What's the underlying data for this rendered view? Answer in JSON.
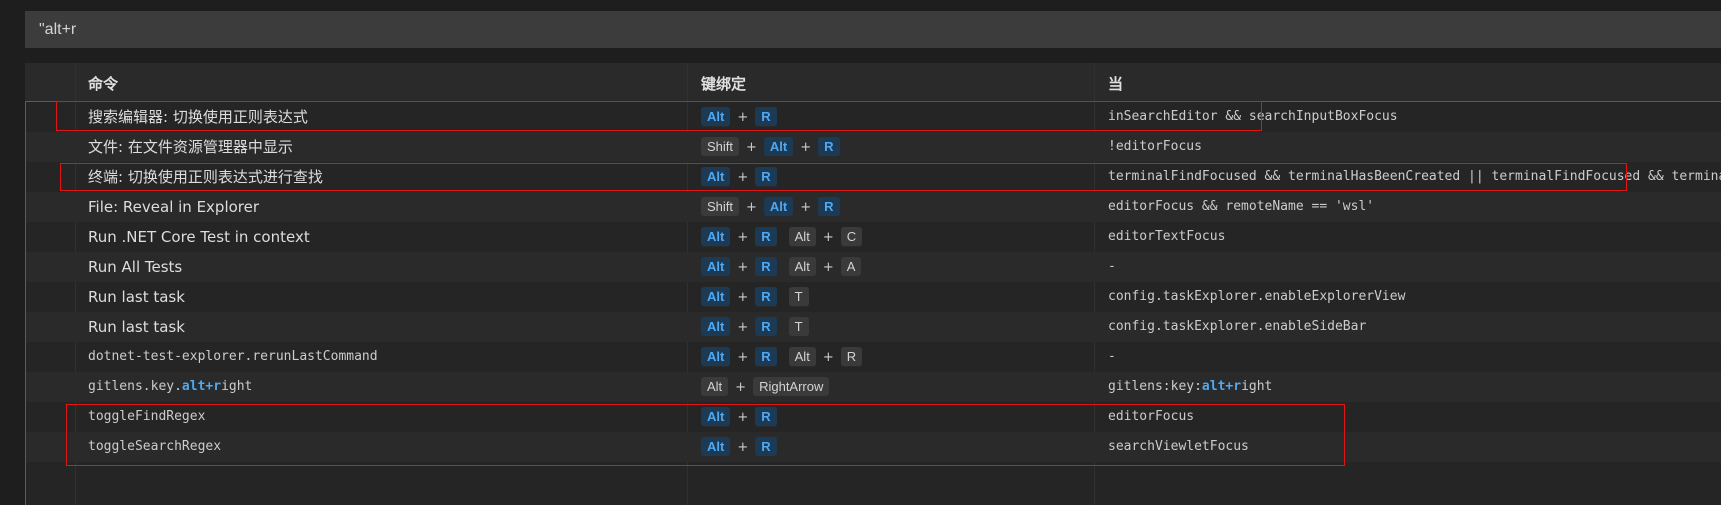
{
  "search": {
    "value": "\"alt+r"
  },
  "headers": {
    "command": "命令",
    "keybinding": "键绑定",
    "when": "当"
  },
  "rows": [
    {
      "cmd_parts": [
        {
          "t": "搜索编辑器: 切换使用正则表达式"
        }
      ],
      "keys": [
        {
          "k": "Alt",
          "hit": true
        },
        {
          "sep": "+"
        },
        {
          "k": "R",
          "hit": true
        }
      ],
      "when_parts": [
        {
          "t": "inSearchEditor && searchInputBoxFocus"
        }
      ]
    },
    {
      "cmd_parts": [
        {
          "t": "文件: 在文件资源管理器中显示"
        }
      ],
      "keys": [
        {
          "k": "Shift",
          "hit": false
        },
        {
          "sep": "+"
        },
        {
          "k": "Alt",
          "hit": true
        },
        {
          "sep": "+"
        },
        {
          "k": "R",
          "hit": true
        }
      ],
      "when_parts": [
        {
          "t": "!editorFocus"
        }
      ]
    },
    {
      "cmd_parts": [
        {
          "t": "终端: 切换使用正则表达式进行查找"
        }
      ],
      "keys": [
        {
          "k": "Alt",
          "hit": true
        },
        {
          "sep": "+"
        },
        {
          "k": "R",
          "hit": true
        }
      ],
      "when_parts": [
        {
          "t": "terminalFindFocused && terminalHasBeenCreated || terminalFindFocused && terminalProcessSupported"
        }
      ]
    },
    {
      "cmd_parts": [
        {
          "t": "File: Reveal in Explorer"
        }
      ],
      "keys": [
        {
          "k": "Shift",
          "hit": false
        },
        {
          "sep": "+"
        },
        {
          "k": "Alt",
          "hit": true
        },
        {
          "sep": "+"
        },
        {
          "k": "R",
          "hit": true
        }
      ],
      "when_parts": [
        {
          "t": "editorFocus && remoteName == 'wsl'"
        }
      ]
    },
    {
      "cmd_parts": [
        {
          "t": "Run .NET Core Test in context"
        }
      ],
      "keys": [
        {
          "k": "Alt",
          "hit": true
        },
        {
          "sep": "+"
        },
        {
          "k": "R",
          "hit": true
        },
        {
          "gap": true
        },
        {
          "k": "Alt",
          "hit": false
        },
        {
          "sep": "+"
        },
        {
          "k": "C",
          "hit": false
        }
      ],
      "when_parts": [
        {
          "t": "editorTextFocus"
        }
      ]
    },
    {
      "cmd_parts": [
        {
          "t": "Run All Tests"
        }
      ],
      "keys": [
        {
          "k": "Alt",
          "hit": true
        },
        {
          "sep": "+"
        },
        {
          "k": "R",
          "hit": true
        },
        {
          "gap": true
        },
        {
          "k": "Alt",
          "hit": false
        },
        {
          "sep": "+"
        },
        {
          "k": "A",
          "hit": false
        }
      ],
      "when_parts": [
        {
          "t": "-"
        }
      ]
    },
    {
      "cmd_parts": [
        {
          "t": "Run last task"
        }
      ],
      "keys": [
        {
          "k": "Alt",
          "hit": true
        },
        {
          "sep": "+"
        },
        {
          "k": "R",
          "hit": true
        },
        {
          "gap": true
        },
        {
          "k": "T",
          "hit": false
        }
      ],
      "when_parts": [
        {
          "t": "config.taskExplorer.enableExplorerView"
        }
      ]
    },
    {
      "cmd_parts": [
        {
          "t": "Run last task"
        }
      ],
      "keys": [
        {
          "k": "Alt",
          "hit": true
        },
        {
          "sep": "+"
        },
        {
          "k": "R",
          "hit": true
        },
        {
          "gap": true
        },
        {
          "k": "T",
          "hit": false
        }
      ],
      "when_parts": [
        {
          "t": "config.taskExplorer.enableSideBar"
        }
      ]
    },
    {
      "mono": true,
      "cmd_parts": [
        {
          "t": "dotnet-test-explorer.rerunLastCommand"
        }
      ],
      "keys": [
        {
          "k": "Alt",
          "hit": true
        },
        {
          "sep": "+"
        },
        {
          "k": "R",
          "hit": true
        },
        {
          "gap": true
        },
        {
          "k": "Alt",
          "hit": false
        },
        {
          "sep": "+"
        },
        {
          "k": "R",
          "hit": false
        }
      ],
      "when_parts": [
        {
          "t": "-"
        }
      ]
    },
    {
      "mono": true,
      "cmd_parts": [
        {
          "t": "gitlens.key."
        },
        {
          "t": "alt+r",
          "hl": true
        },
        {
          "t": "ight"
        }
      ],
      "keys": [
        {
          "k": "Alt",
          "hit": false
        },
        {
          "sep": "+"
        },
        {
          "k": "RightArrow",
          "hit": false
        }
      ],
      "when_parts": [
        {
          "t": "gitlens:key:"
        },
        {
          "t": "alt+r",
          "hl": true
        },
        {
          "t": "ight"
        }
      ]
    },
    {
      "mono": true,
      "cmd_parts": [
        {
          "t": "toggleFindRegex"
        }
      ],
      "keys": [
        {
          "k": "Alt",
          "hit": true
        },
        {
          "sep": "+"
        },
        {
          "k": "R",
          "hit": true
        }
      ],
      "when_parts": [
        {
          "t": "editorFocus"
        }
      ]
    },
    {
      "mono": true,
      "cmd_parts": [
        {
          "t": "toggleSearchRegex"
        }
      ],
      "keys": [
        {
          "k": "Alt",
          "hit": true
        },
        {
          "sep": "+"
        },
        {
          "k": "R",
          "hit": true
        }
      ],
      "when_parts": [
        {
          "t": "searchViewletFocus"
        }
      ]
    }
  ]
}
